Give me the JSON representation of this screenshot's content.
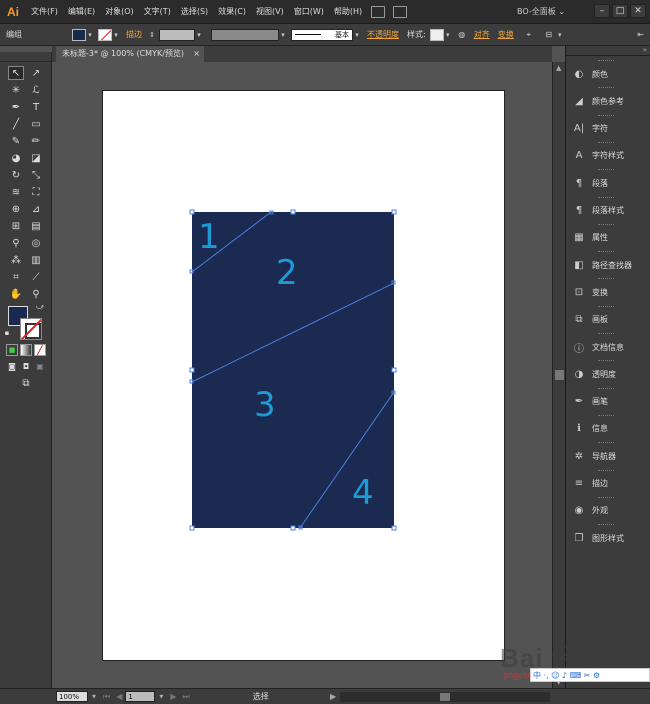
{
  "app": {
    "logo": "Ai",
    "workspace": "BO-全面板",
    "workspace_arrow": "⌄"
  },
  "menu": [
    "文件(F)",
    "编辑(E)",
    "对象(O)",
    "文字(T)",
    "选择(S)",
    "效果(C)",
    "视图(V)",
    "窗口(W)",
    "帮助(H)"
  ],
  "window_buttons": [
    "–",
    "□",
    "✕"
  ],
  "control_bar": {
    "mode_label": "编组",
    "stroke_label": "描边",
    "stroke_style": "基本",
    "opacity_label": "不透明度",
    "style_label": "样式:",
    "align_label": "对齐",
    "transform_label": "变换",
    "fill_color": "#1a2950"
  },
  "document": {
    "tab_title": "未标题-3* @ 100% (CMYK/预览)",
    "close": "×"
  },
  "artwork": {
    "fill_color": "#1a2a50",
    "line_color": "#4a7fe0",
    "number_color": "#1e9ad6",
    "labels": [
      "1",
      "2",
      "3",
      "4"
    ]
  },
  "panels": [
    {
      "icon": "color-icon",
      "glyph": "◐",
      "label": "颜色"
    },
    {
      "icon": "color-guide-icon",
      "glyph": "◢",
      "label": "颜色参考"
    },
    {
      "icon": "character-icon",
      "glyph": "A|",
      "label": "字符"
    },
    {
      "icon": "character-style-icon",
      "glyph": "A",
      "label": "字符样式"
    },
    {
      "icon": "paragraph-icon",
      "glyph": "¶",
      "label": "段落"
    },
    {
      "icon": "paragraph-style-icon",
      "glyph": "¶",
      "label": "段落样式"
    },
    {
      "icon": "attributes-icon",
      "glyph": "▦",
      "label": "属性"
    },
    {
      "icon": "pathfinder-icon",
      "glyph": "◧",
      "label": "路径查找器"
    },
    {
      "icon": "transform-icon",
      "glyph": "⊡",
      "label": "变换"
    },
    {
      "icon": "artboards-icon",
      "glyph": "⧉",
      "label": "画板"
    },
    {
      "icon": "document-info-icon",
      "glyph": "ⓘ",
      "label": "文档信息"
    },
    {
      "icon": "transparency-icon",
      "glyph": "◑",
      "label": "透明度"
    },
    {
      "icon": "brushes-icon",
      "glyph": "✒",
      "label": "画笔"
    },
    {
      "icon": "info-icon",
      "glyph": "ℹ",
      "label": "信息"
    },
    {
      "icon": "navigator-icon",
      "glyph": "✲",
      "label": "导航器"
    },
    {
      "icon": "stroke-icon",
      "glyph": "≡",
      "label": "描边"
    },
    {
      "icon": "appearance-icon",
      "glyph": "◉",
      "label": "外观"
    },
    {
      "icon": "graphic-styles-icon",
      "glyph": "❐",
      "label": "图形样式"
    }
  ],
  "status": {
    "zoom": "100%",
    "page": "1",
    "tool": "选择"
  },
  "watermark": {
    "text": "Bai 经验",
    "url": "jingyan.baidu.com",
    "ime": "中 ·, ☺ ♪ ⌨ ✂ ⚙"
  }
}
